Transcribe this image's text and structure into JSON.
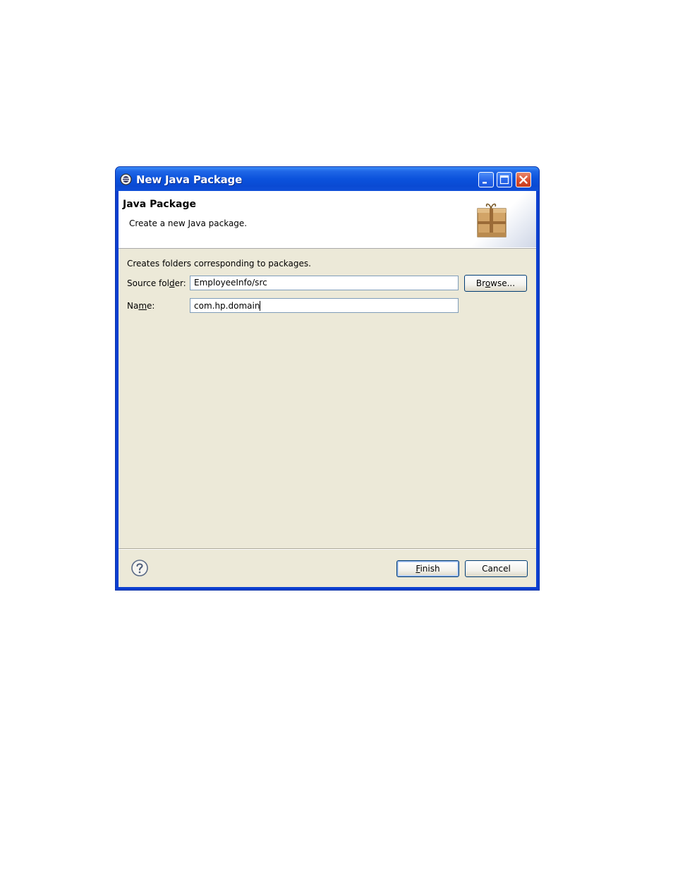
{
  "window": {
    "title": "New Java Package",
    "controls": {
      "minimize": "minimize",
      "maximize": "maximize",
      "close": "close"
    }
  },
  "banner": {
    "title": "Java Package",
    "description": "Create a new Java package."
  },
  "form": {
    "description": "Creates folders corresponding to packages.",
    "source_folder": {
      "label_pre": "Source fol",
      "label_mnemonic": "d",
      "label_post": "er:",
      "value": "EmployeeInfo/src"
    },
    "name": {
      "label_pre": "Na",
      "label_mnemonic": "m",
      "label_post": "e:",
      "value": "com.hp.domain"
    },
    "browse": {
      "pre": "Br",
      "mnemonic": "o",
      "post": "wse..."
    }
  },
  "footer": {
    "finish": {
      "mnemonic": "F",
      "post": "inish"
    },
    "cancel": "Cancel"
  },
  "icons": [
    "eclipse-app-icon",
    "package-icon",
    "help-icon"
  ],
  "colors": {
    "titlebar": "#0b52dc",
    "dialog_bg": "#ece9d8",
    "close_button": "#d94d2d"
  }
}
